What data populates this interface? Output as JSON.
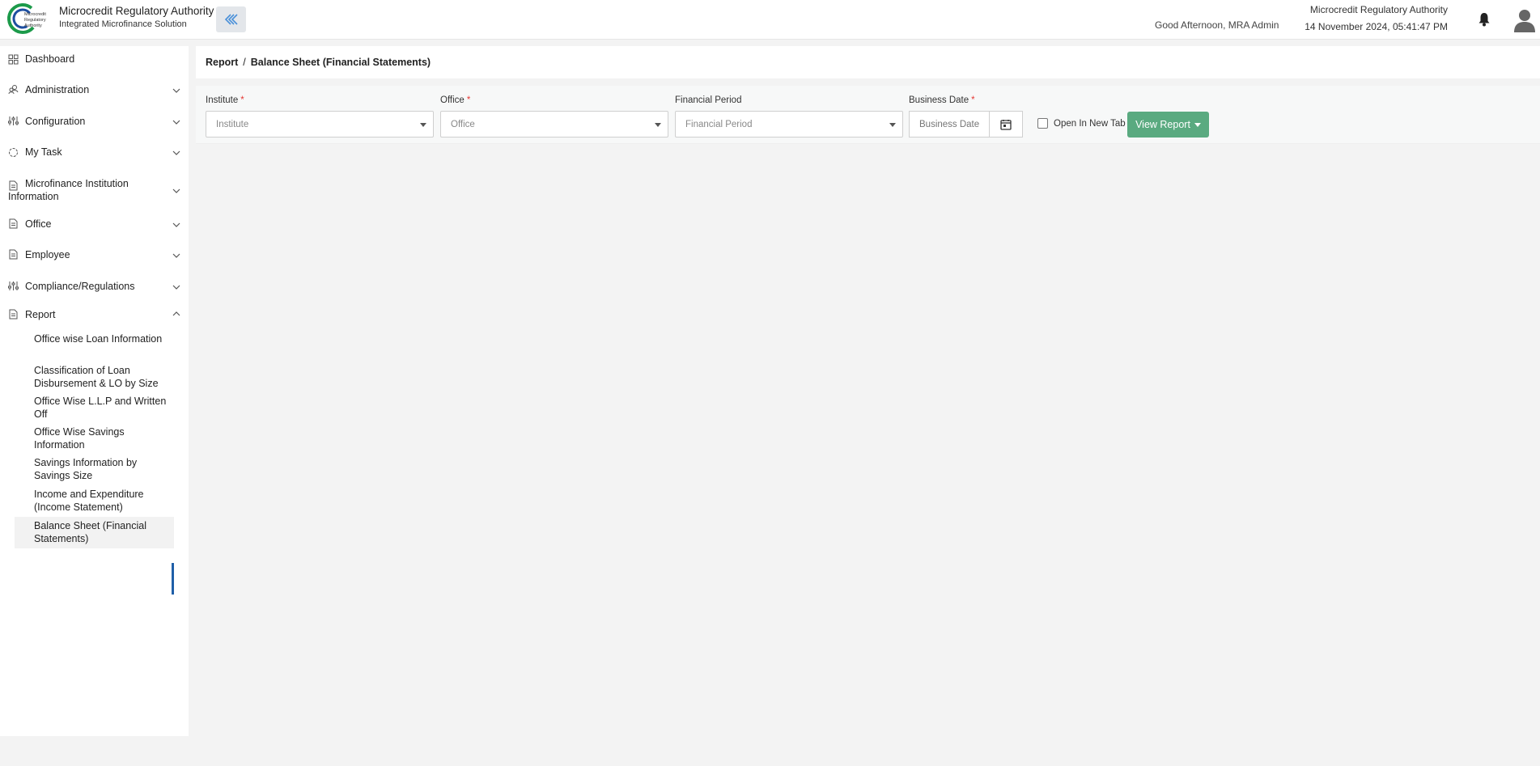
{
  "header": {
    "brand_title": "Microcredit Regulatory Authority",
    "brand_subtitle": "Integrated Microfinance Solution",
    "greeting": "Good Afternoon, MRA Admin",
    "org_name": "Microcredit Regulatory Authority",
    "datetime": "14 November 2024, 05:41:47 PM",
    "logo_text": [
      "Microcredit",
      "Regulatory",
      "Authority"
    ]
  },
  "sidebar": {
    "items": [
      {
        "label": "Dashboard",
        "icon": "grid-icon"
      },
      {
        "label": "Administration",
        "icon": "users-icon"
      },
      {
        "label": "Configuration",
        "icon": "sliders-icon"
      },
      {
        "label": "My Task",
        "icon": "circle-icon"
      },
      {
        "label": "Microfinance Institution Information",
        "icon": "document-icon"
      },
      {
        "label": "Office",
        "icon": "document-icon"
      },
      {
        "label": "Employee",
        "icon": "document-icon"
      },
      {
        "label": "Compliance/Regulations",
        "icon": "sliders-icon"
      },
      {
        "label": "Report",
        "icon": "document-icon"
      }
    ],
    "report_subitems": [
      "Office wise Loan Information",
      "Classification of Loan Disbursement & LO by Size",
      "Office Wise L.L.P and Written Off",
      "Office Wise Savings Information",
      "Savings Information by Savings Size",
      "Income and Expenditure (Income Statement)",
      "Balance Sheet (Financial Statements)"
    ]
  },
  "breadcrumb": {
    "root": "Report",
    "separator": "/",
    "current": "Balance Sheet (Financial Statements)"
  },
  "filters": {
    "institute": {
      "label": "Institute",
      "required": "*",
      "placeholder": "Institute"
    },
    "office": {
      "label": "Office",
      "required": "*",
      "placeholder": "Office"
    },
    "financial_period": {
      "label": "Financial Period",
      "placeholder": "Financial Period"
    },
    "business_date": {
      "label": "Business Date",
      "required": "*",
      "placeholder": "Business Date"
    },
    "open_new_tab_label": "Open In New Tab",
    "view_report_label": "View Report"
  },
  "colors": {
    "accent_green": "#5aaa80",
    "active_bar": "#1f5fa8",
    "required": "#e53935"
  }
}
